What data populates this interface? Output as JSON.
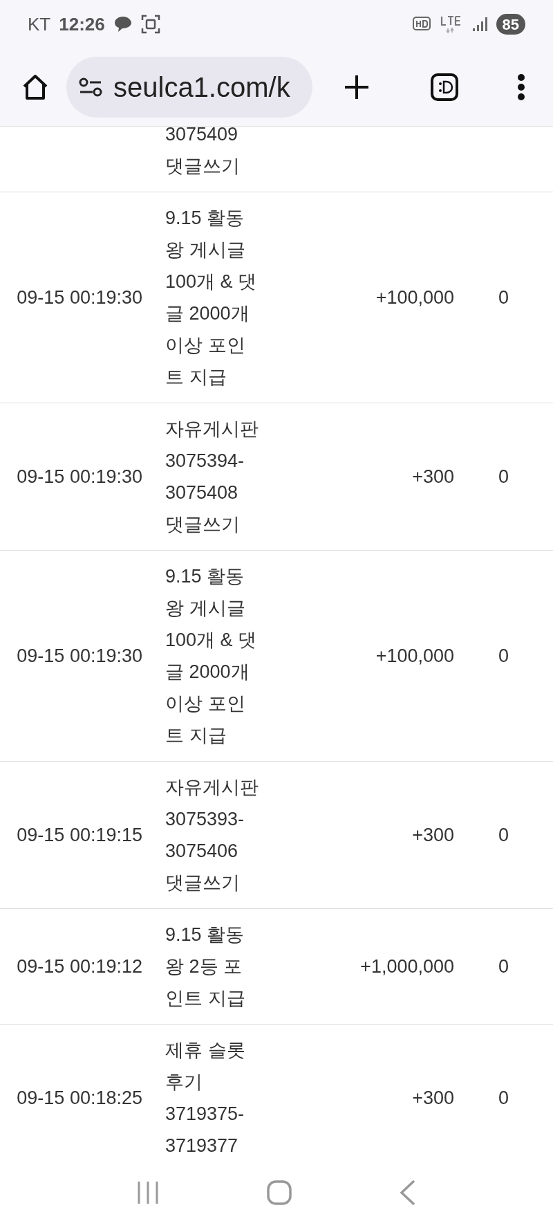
{
  "status_bar": {
    "carrier": "KT",
    "time": "12:26",
    "battery": "85"
  },
  "browser": {
    "url": "seulca1.com/k"
  },
  "rows": [
    {
      "date": "",
      "description": "3075409 댓글쓰기",
      "amount": "",
      "balance": ""
    },
    {
      "date": "09-15 00:19:30",
      "description": "9.15 활동왕 게시글 100개 & 댓글 2000개 이상 포인트 지급",
      "amount": "+100,000",
      "balance": "0"
    },
    {
      "date": "09-15 00:19:30",
      "description": "자유게시판 3075394-3075408 댓글쓰기",
      "amount": "+300",
      "balance": "0"
    },
    {
      "date": "09-15 00:19:30",
      "description": "9.15 활동왕 게시글 100개 & 댓글 2000개 이상 포인트 지급",
      "amount": "+100,000",
      "balance": "0"
    },
    {
      "date": "09-15 00:19:15",
      "description": "자유게시판 3075393-3075406 댓글쓰기",
      "amount": "+300",
      "balance": "0"
    },
    {
      "date": "09-15 00:19:12",
      "description": "9.15 활동왕 2등 포인트 지급",
      "amount": "+1,000,000",
      "balance": "0"
    },
    {
      "date": "09-15 00:18:25",
      "description": "제휴 슬롯 후기 3719375-3719377",
      "amount": "+300",
      "balance": "0"
    }
  ]
}
